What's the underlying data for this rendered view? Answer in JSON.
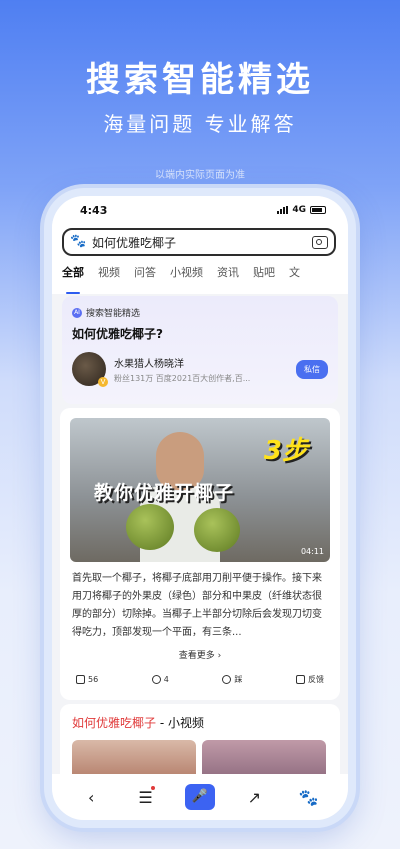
{
  "hero": {
    "title": "搜索智能精选",
    "subtitle": "海量问题 专业解答",
    "disclaimer": "以端内实际页面为准"
  },
  "status_bar": {
    "time": "4:43",
    "network": "4G"
  },
  "search": {
    "query": "如何优雅吃椰子"
  },
  "tabs": [
    "全部",
    "视频",
    "问答",
    "小视频",
    "资讯",
    "贴吧",
    "文"
  ],
  "ai_card": {
    "label": "搜索智能精选",
    "question": "如何优雅吃椰子?",
    "author_name": "水果猎人杨晓洋",
    "author_meta": "粉丝131万  百度2021百大创作者,百...",
    "message_button": "私信"
  },
  "video": {
    "step_text": "3步",
    "caption": "教你优雅开椰子",
    "duration": "04:11"
  },
  "article": {
    "text": "首先取一个椰子，将椰子底部用刀削平便于操作。接下来用刀将椰子的外果皮（绿色）部分和中果皮（纤维状态很厚的部分）切除掉。当椰子上半部分切除后会发现刀切变得吃力，顶部发现一个平面，有三条...",
    "see_more": "查看更多"
  },
  "actions": {
    "comments": "56",
    "likes": "4",
    "dislike": "踩",
    "feedback": "反馈"
  },
  "video_section": {
    "title_highlight": "如何优雅吃椰子",
    "title_suffix": " - 小视频"
  },
  "bottom_nav": {
    "back": "‹",
    "menu": "☰",
    "mic": "🎤",
    "share": "↗",
    "paw": "🐾"
  }
}
